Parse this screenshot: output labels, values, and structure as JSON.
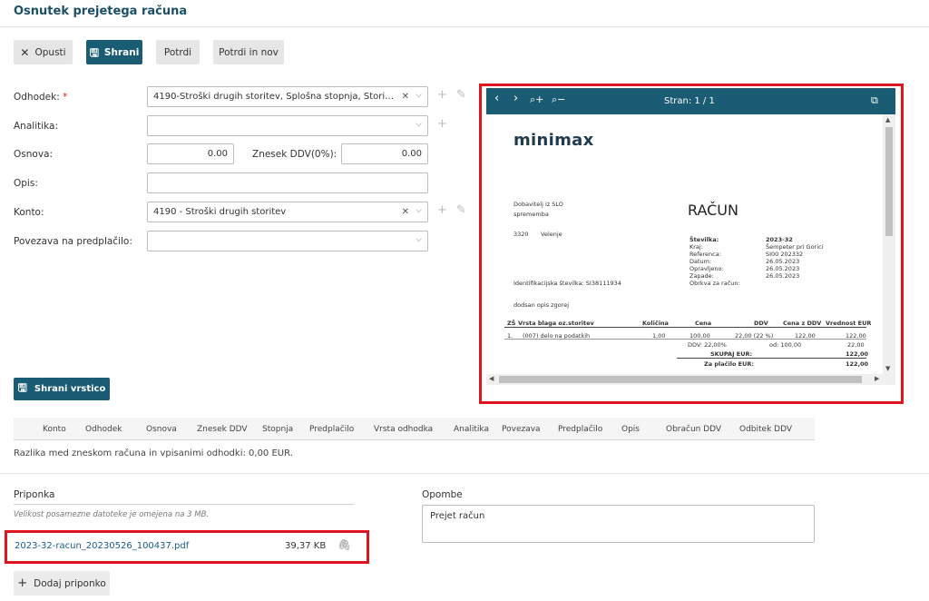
{
  "header": {
    "title": "Osnutek prejetega računa"
  },
  "toolbar": {
    "discard": "Opusti",
    "save": "Shrani",
    "confirm": "Potrdi",
    "confirm_new": "Potrdi in nov"
  },
  "form": {
    "odhodek_label": "Odhodek:",
    "odhodek_required": "*",
    "odhodek_value": "4190-Stroški drugih storitev, Splošna stopnja, Storitve, Nav...",
    "analitika_label": "Analitika:",
    "analitika_value": "",
    "osnova_label": "Osnova:",
    "osnova_value": "0.00",
    "ddv_label": "Znesek DDV(0%):",
    "ddv_value": "0.00",
    "opis_label": "Opis:",
    "opis_value": "",
    "konto_label": "Konto:",
    "konto_value": "4190 - Stroški drugih storitev",
    "povezava_label": "Povezava na predplačilo:",
    "povezava_value": "",
    "save_line": "Shrani vrstico"
  },
  "table": {
    "headers": [
      "Konto",
      "Odhodek",
      "Osnova",
      "Znesek DDV",
      "Stopnja",
      "Predplačilo",
      "Vrsta odhodka",
      "Analitika",
      "Povezava",
      "Predplačilo",
      "Opis",
      "Obračun DDV",
      "Odbitek DDV"
    ],
    "difference": "Razlika med zneskom računa in vpisanimi odhodki: 0,00 EUR."
  },
  "attachments": {
    "title": "Priponka",
    "hint": "Velikost posamezne datoteke je omejena na 3 MB.",
    "file_name": "2023-32-racun_20230526_100437.pdf",
    "file_size": "39,37 KB",
    "add_button": "Dodaj priponko"
  },
  "notes": {
    "title": "Opombe",
    "value": "Prejet račun"
  },
  "viewer": {
    "page_label": "Stran: 1 / 1",
    "doc": {
      "logo": "minimax",
      "supplier_line1": "Dobavitelj iz SLO",
      "supplier_line2": "sprememba",
      "supplier_post": "3320",
      "supplier_city": "Velenje",
      "supplier_id": "Identifikacijska številka: SI38111934",
      "invoice_title": "RAČUN",
      "meta_labels": [
        "Številka:",
        "Kraj:",
        "Referenca:",
        "Datum:",
        "Opravljeno:",
        "Zapade:",
        "Obrkva za račun:"
      ],
      "meta_values": [
        "2023-32",
        "Šempeter pri Gorici",
        "SI00 202332",
        "26.05.2023",
        "26.05.2023",
        "26.05.2023",
        ""
      ],
      "description": "dodsan opis zgorej",
      "col_headers": [
        "ZŠ",
        "Vrsta blaga oz.storitev",
        "Količina",
        "Cena",
        "DDV",
        "Cena z DDV",
        "Vrednost EUR"
      ],
      "row": [
        "1.",
        "(007) delo na podatkih",
        "1,00",
        "100,00",
        "22,00 (22 %)",
        "122,00",
        "122,00"
      ],
      "vat_line": "DDV: 22,00%",
      "vat_base": "od: 100,00",
      "vat_value": "22,00",
      "total_label": "SKUPAJ EUR:",
      "total_value": "122,00",
      "pay_label": "Za plačilo EUR:",
      "pay_value": "122,00"
    }
  }
}
